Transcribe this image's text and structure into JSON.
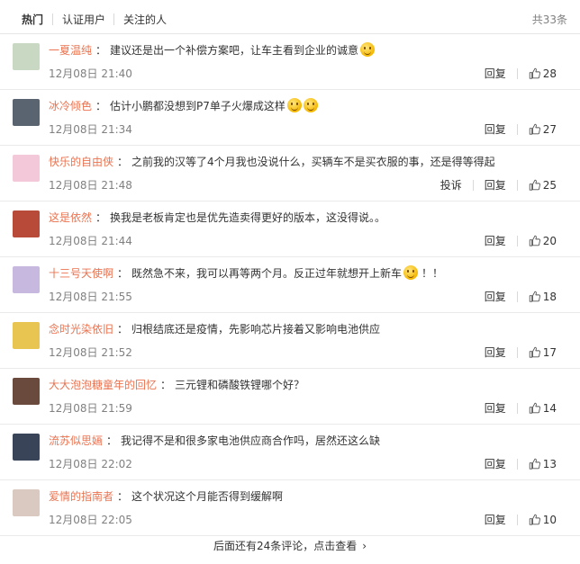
{
  "tabs": [
    {
      "label": "热门"
    },
    {
      "label": "认证用户"
    },
    {
      "label": "关注的人"
    }
  ],
  "total_count": "共33条",
  "comments": [
    {
      "user": "一夏温纯",
      "text": "建议还是出一个补偿方案吧，让车主看到企业的诚意",
      "emoji": 1,
      "time": "12月08日 21:40",
      "reply": "回复",
      "likes": "28",
      "avatar_color": "#c9d8c2"
    },
    {
      "user": "冰冷倾色",
      "text": "估计小鹏都没想到P7单子火爆成这样",
      "emoji": 2,
      "time": "12月08日 21:34",
      "reply": "回复",
      "likes": "27",
      "avatar_color": "#5a6470"
    },
    {
      "user": "快乐的自由侠",
      "text": "之前我的汉等了4个月我也没说什么，买辆车不是买衣服的事，还是得等得起",
      "emoji": 0,
      "time": "12月08日 21:48",
      "report": "投诉",
      "reply": "回复",
      "likes": "25",
      "avatar_color": "#f3c8d8"
    },
    {
      "user": "这是依然",
      "text": "换我是老板肯定也是优先造卖得更好的版本，这没得说。。",
      "emoji": 0,
      "time": "12月08日 21:44",
      "reply": "回复",
      "likes": "20",
      "avatar_color": "#b84a3a"
    },
    {
      "user": "十三号天使啊",
      "text": "既然急不来，我可以再等两个月。反正过年就想开上新车",
      "emoji": 1,
      "text_after": "！！",
      "time": "12月08日 21:55",
      "reply": "回复",
      "likes": "18",
      "avatar_color": "#c7b8e0"
    },
    {
      "user": "念时光染依旧",
      "text": "归根结底还是疫情，先影响芯片接着又影响电池供应",
      "emoji": 0,
      "time": "12月08日 21:52",
      "reply": "回复",
      "likes": "17",
      "avatar_color": "#e8c450"
    },
    {
      "user": "大大泡泡糖童年的回忆",
      "text": "三元锂和磷酸铁锂哪个好？",
      "emoji": 0,
      "time": "12月08日 21:59",
      "reply": "回复",
      "likes": "14",
      "avatar_color": "#6b4a3e"
    },
    {
      "user": "流苏似思婳",
      "text": "我记得不是和很多家电池供应商合作吗，居然还这么缺",
      "emoji": 0,
      "time": "12月08日 22:02",
      "reply": "回复",
      "likes": "13",
      "avatar_color": "#3a4458"
    },
    {
      "user": "爱情的指南者",
      "text": "这个状况这个月能否得到缓解啊",
      "emoji": 0,
      "time": "12月08日 22:05",
      "reply": "回复",
      "likes": "10",
      "avatar_color": "#d9c9c0"
    }
  ],
  "more_text": "后面还有24条评论，点击查看",
  "more_chevron": "›",
  "colors": {
    "username": "#eb7350",
    "meta": "#808080",
    "divider": "#eaeaea"
  }
}
